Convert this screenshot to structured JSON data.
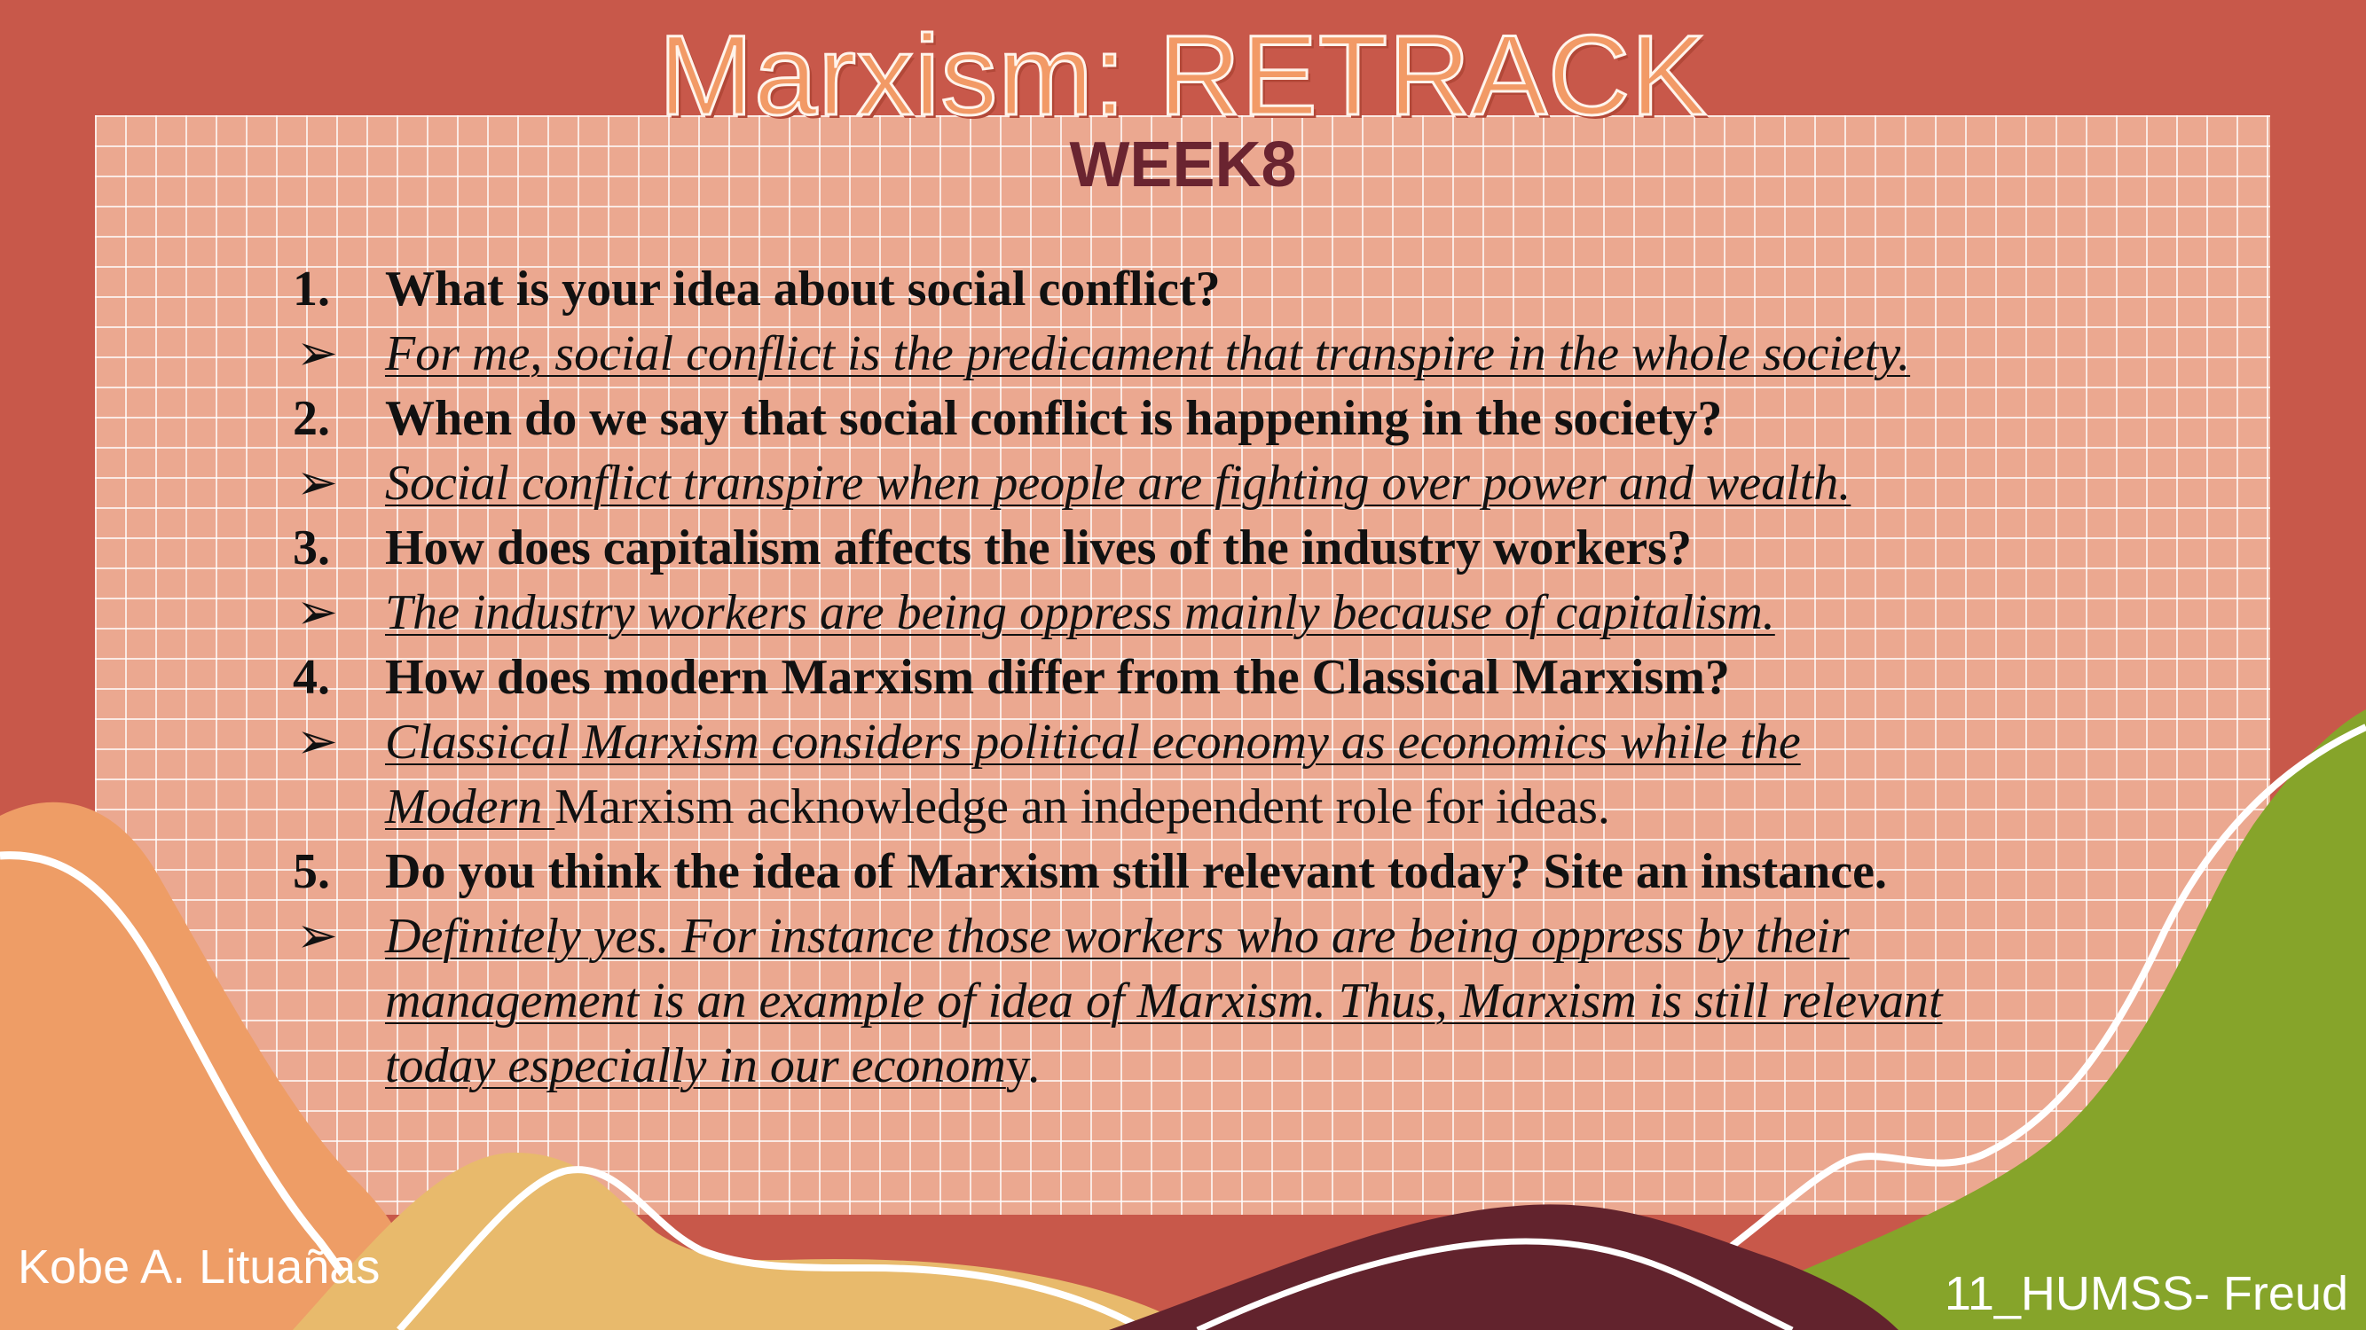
{
  "slide": {
    "title": "Marxism: RETRACK",
    "subtitle": "WEEK8",
    "author": "Kobe A. Lituañas",
    "section": "11_HUMSS- Freud"
  },
  "qa": [
    {
      "number": "1.",
      "question": "What is your idea about social conflict?",
      "answer": "For me, social conflict is the predicament that transpire in the whole society."
    },
    {
      "number": "2.",
      "question": "When do we say that social conflict is happening in the society?",
      "answer": "Social conflict transpire when people are fighting over power and wealth."
    },
    {
      "number": "3.",
      "question": "How does capitalism affects the lives of the industry workers?",
      "answer": "The industry workers are being oppress mainly because of capitalism."
    },
    {
      "number": "4.",
      "question": "How does modern Marxism differ from the Classical Marxism?",
      "answer_line1": "Classical Marxism considers political economy as economics while the",
      "answer_line2_emph": "Modern ",
      "answer_line2_rest": "Marxism acknowledge an independent role for ideas."
    },
    {
      "number": "5.",
      "question": "Do you think the idea of Marxism still relevant today? Site an instance.",
      "answer_line1": "Definitely yes. For instance those workers who are being oppress by their",
      "answer_line2": "management is an example of idea of Marxism. Thus, Marxism is still relevant",
      "answer_line3_emph": "today especially in our econom",
      "answer_line3_rest": "y."
    }
  ],
  "bullet_marker": "➢",
  "colors": {
    "background": "#c8584a",
    "grid_panel": "#eba890",
    "title": "#f29a66",
    "subtitle": "#6a2430",
    "hill_orange": "#ee9d66",
    "hill_yellow": "#e8ba6c",
    "hill_maroon": "#62232d",
    "hill_green": "#86a42a"
  }
}
